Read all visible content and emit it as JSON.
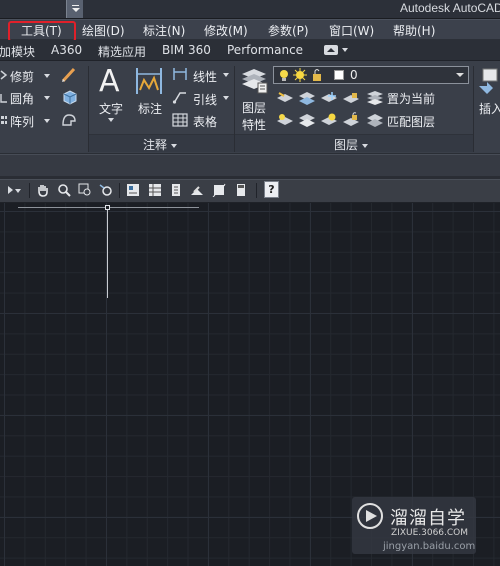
{
  "title_bar": {
    "app_title": "Autodesk AutoCAD"
  },
  "menu_bar": {
    "items": [
      {
        "label": "工具(T)",
        "highlighted": true
      },
      {
        "label": "绘图(D)"
      },
      {
        "label": "标注(N)"
      },
      {
        "label": "修改(M)"
      },
      {
        "label": "参数(P)"
      },
      {
        "label": "窗口(W)"
      },
      {
        "label": "帮助(H)"
      }
    ],
    "highlight_color": "#e0202a"
  },
  "ribbon_tabs": [
    "加模块",
    "A360",
    "精选应用",
    "BIM 360",
    "Performance"
  ],
  "ribbon": {
    "modify_panel": {
      "modify": "修剪",
      "fillet": "圆角",
      "array": "阵列"
    },
    "annotation_panel": {
      "text": "文字",
      "dimension": "标注",
      "linear": "线性",
      "leader": "引线",
      "table": "表格",
      "title": "注释"
    },
    "layers_panel": {
      "layer_properties_line1": "图层",
      "layer_properties_line2": "特性",
      "current_layer": "0",
      "current_layer_color": "#ffffff",
      "set_current": "置为当前",
      "match_layer": "匹配图层",
      "title": "图层"
    },
    "insert_panel": {
      "insert": "插入"
    }
  },
  "toolbar": {
    "help": "?"
  },
  "watermark": {
    "name": "溜溜自学",
    "url": "ZIXUE.3066.COM",
    "sub": "jingyan.baidu.com"
  }
}
